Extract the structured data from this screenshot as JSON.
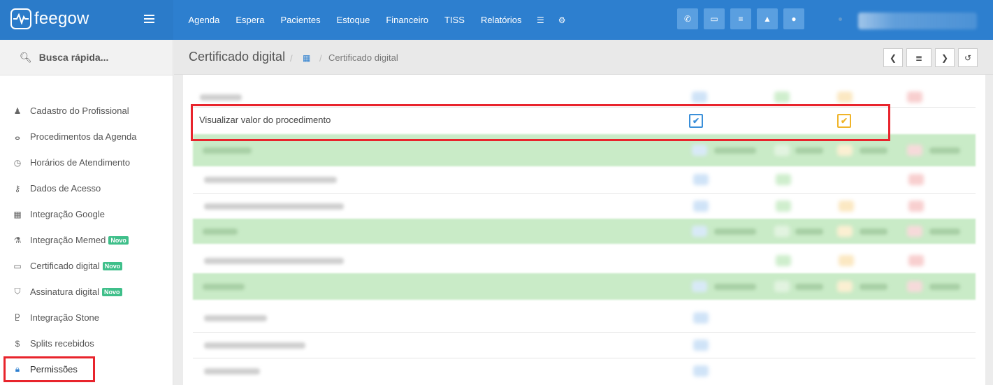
{
  "brand": {
    "name": "feegow"
  },
  "nav": {
    "items": [
      "Agenda",
      "Espera",
      "Pacientes",
      "Estoque",
      "Financeiro",
      "TISS",
      "Relatórios"
    ]
  },
  "topbar_icons": [
    "phone-icon",
    "inbox-icon",
    "list-icon",
    "bell-icon",
    "chat-icon"
  ],
  "sidebar": {
    "search_label": "Busca rápida...",
    "items": [
      {
        "label": "Cadastro do Profissional",
        "icon": "user-icon",
        "badge": ""
      },
      {
        "label": "Procedimentos da Agenda",
        "icon": "stethoscope-icon",
        "badge": ""
      },
      {
        "label": "Horários de Atendimento",
        "icon": "clock-icon",
        "badge": ""
      },
      {
        "label": "Dados de Acesso",
        "icon": "key-icon",
        "badge": ""
      },
      {
        "label": "Integração Google",
        "icon": "calendar-icon",
        "badge": ""
      },
      {
        "label": "Integração Memed",
        "icon": "flask-icon",
        "badge": "Novo"
      },
      {
        "label": "Certificado digital",
        "icon": "card-icon",
        "badge": "Novo"
      },
      {
        "label": "Assinatura digital",
        "icon": "shield-icon",
        "badge": "Novo"
      },
      {
        "label": "Integração Stone",
        "icon": "stone-icon",
        "badge": ""
      },
      {
        "label": "Splits recebidos",
        "icon": "dollar-icon",
        "badge": ""
      },
      {
        "label": "Permissões",
        "icon": "lock-icon",
        "badge": ""
      }
    ]
  },
  "breadcrumb": {
    "title": "Certificado digital",
    "separator": "/",
    "current": "Certificado digital"
  },
  "permission_row": {
    "label": "Visualizar valor do procedimento",
    "view_checked": true,
    "edit_checked": true
  },
  "colors": {
    "primary": "#2d7fcf",
    "view": "#3a8fd9",
    "edit": "#f0b429",
    "highlight": "#e8242c",
    "badge": "#3fbf8a"
  }
}
